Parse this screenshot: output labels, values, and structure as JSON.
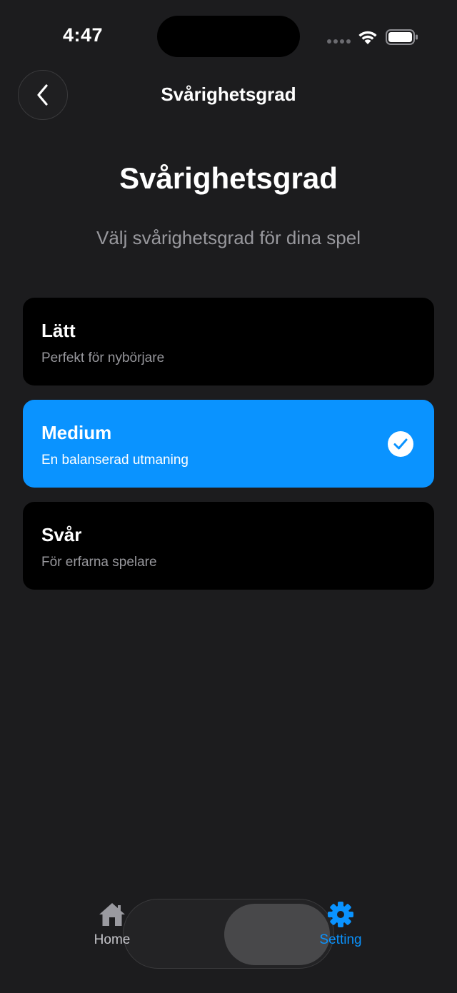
{
  "status_bar": {
    "time": "4:47"
  },
  "nav": {
    "title": "Svårighetsgrad"
  },
  "header": {
    "title": "Svårighetsgrad",
    "subtitle": "Välj svårighetsgrad för dina spel"
  },
  "options": [
    {
      "title": "Lätt",
      "description": "Perfekt för nybörjare",
      "selected": false
    },
    {
      "title": "Medium",
      "description": "En balanserad utmaning",
      "selected": true
    },
    {
      "title": "Svår",
      "description": "För erfarna spelare",
      "selected": false
    }
  ],
  "tabbar": {
    "home_label": "Home",
    "setting_label": "Setting"
  },
  "colors": {
    "background": "#1c1c1e",
    "accent": "#0a93ff",
    "card": "#000000"
  }
}
